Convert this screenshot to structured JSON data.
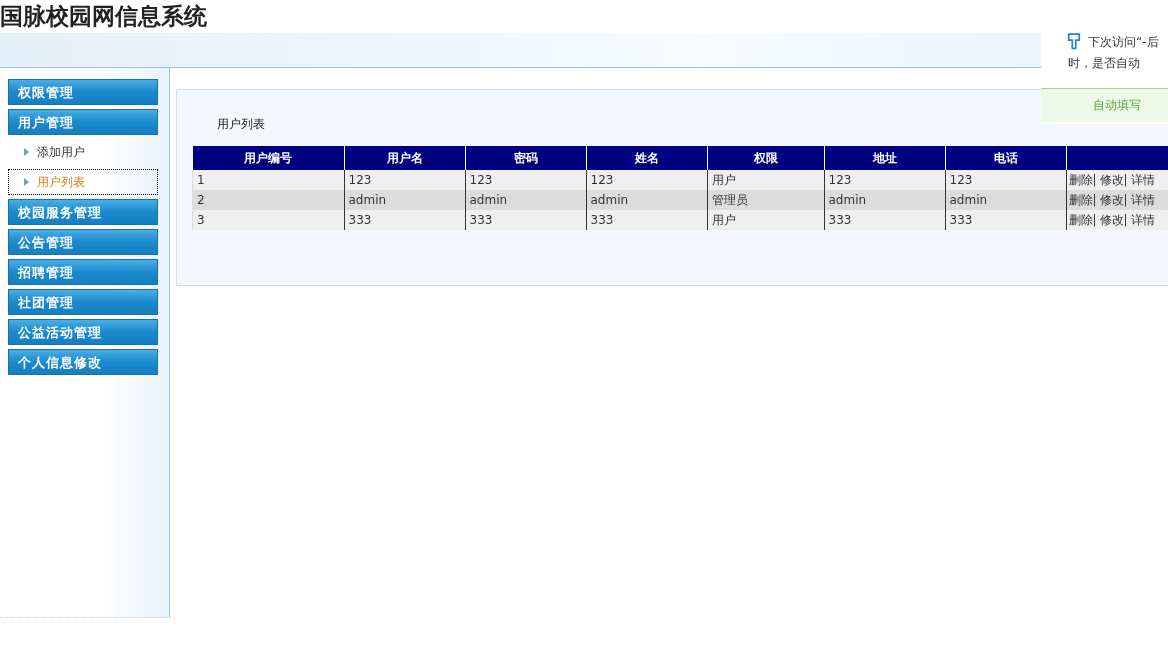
{
  "title": "国脉校园网信息系统",
  "sidebar": {
    "items": [
      {
        "kind": "group",
        "label": "权限管理"
      },
      {
        "kind": "group",
        "label": "用户管理",
        "children": [
          {
            "label": "添加用户",
            "selected": false
          },
          {
            "label": "用户列表",
            "selected": true
          }
        ]
      },
      {
        "kind": "group",
        "label": "校园服务管理"
      },
      {
        "kind": "group",
        "label": "公告管理"
      },
      {
        "kind": "group",
        "label": "招聘管理"
      },
      {
        "kind": "group",
        "label": "社团管理"
      },
      {
        "kind": "group",
        "label": "公益活动管理"
      },
      {
        "kind": "group",
        "label": "个人信息修改"
      }
    ]
  },
  "panel": {
    "title": "用户列表",
    "table": {
      "columns": [
        "用户编号",
        "用户名",
        "密码",
        "姓名",
        "权限",
        "地址",
        "电话"
      ],
      "rows": [
        {
          "cells": [
            "1",
            "123",
            "123",
            "123",
            "用户",
            "123",
            "123"
          ],
          "actions": [
            "删除|",
            "修改|",
            "详情"
          ]
        },
        {
          "cells": [
            "2",
            "admin",
            "admin",
            "admin",
            "管理员",
            "admin",
            "admin"
          ],
          "actions": [
            "删除|",
            "修改|",
            "详情"
          ]
        },
        {
          "cells": [
            "3",
            "333",
            "333",
            "333",
            "用户",
            "333",
            "333"
          ],
          "actions": [
            "删除|",
            "修改|",
            "详情"
          ]
        }
      ]
    }
  },
  "popup": {
    "lines": [
      "下次访问“-后",
      "时，是否自动"
    ],
    "button": "自动填写"
  }
}
